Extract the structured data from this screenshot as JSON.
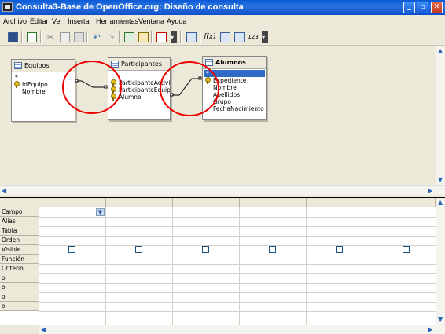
{
  "window": {
    "title": "Consulta3-Base de OpenOffice.org: Diseño de consulta"
  },
  "menu": [
    "Archivo",
    "Editar",
    "Ver",
    "Insertar",
    "Herramientas",
    "Ventana",
    "Ayuda"
  ],
  "tables": [
    {
      "name": "Equipos",
      "fields": [
        "*",
        "IdEquipo",
        "Nombre"
      ]
    },
    {
      "name": "Participantes",
      "fields": [
        "ParticipanteActividad",
        "ParticipanteEquipo",
        "Alumno"
      ]
    },
    {
      "name": "Alumnos",
      "fields": [
        "*",
        "Expediente",
        "Nombre",
        "Apellidos",
        "Grupo",
        "FechaNacimiento"
      ]
    }
  ],
  "grid": {
    "row_labels": [
      "Campo",
      "Alias",
      "Tabla",
      "Orden",
      "Visible",
      "Función",
      "Criterio",
      "o",
      "o",
      "o",
      "o"
    ]
  }
}
